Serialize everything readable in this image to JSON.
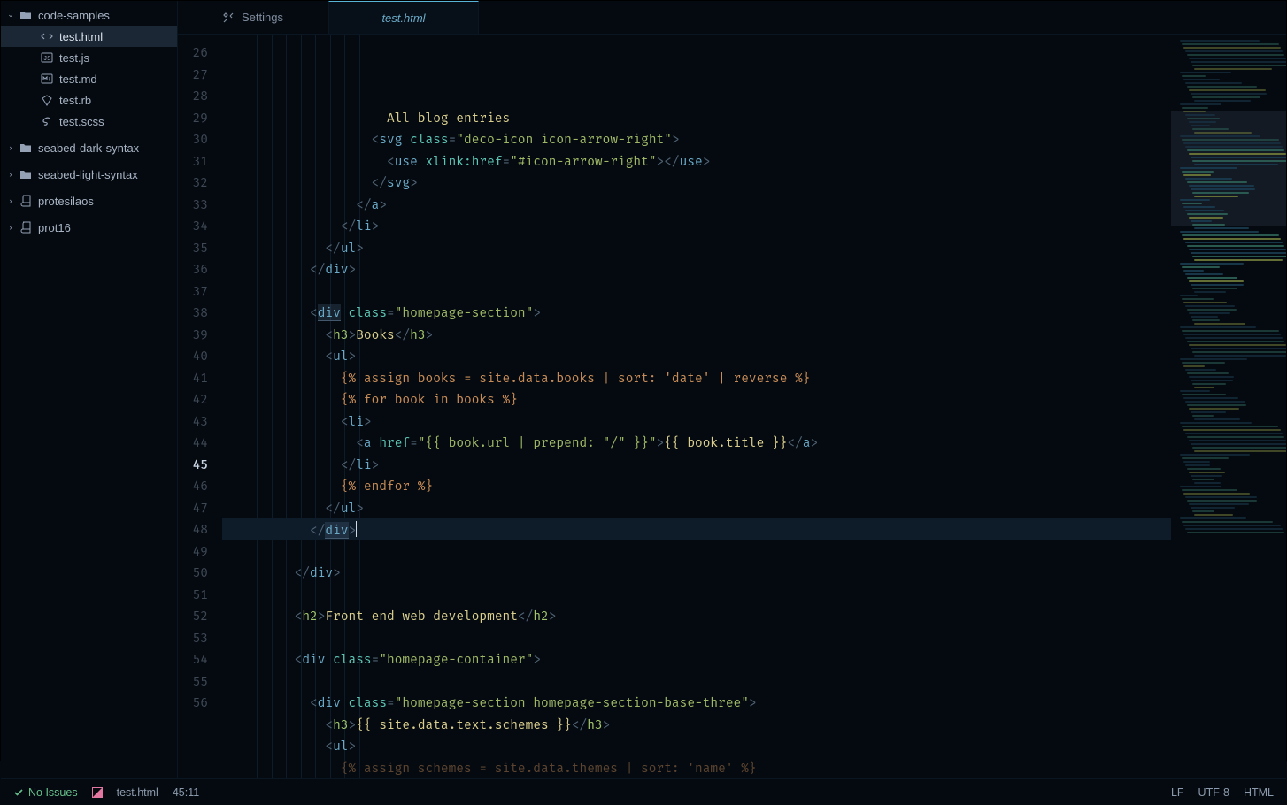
{
  "tree": {
    "root": {
      "name": "code-samples",
      "expanded": true,
      "files": [
        {
          "name": "test.html",
          "kind": "html",
          "active": true
        },
        {
          "name": "test.js",
          "kind": "js",
          "active": false
        },
        {
          "name": "test.md",
          "kind": "md",
          "active": false
        },
        {
          "name": "test.rb",
          "kind": "rb",
          "active": false
        },
        {
          "name": "test.scss",
          "kind": "scss",
          "active": false
        }
      ]
    },
    "siblings": [
      {
        "name": "seabed-dark-syntax",
        "icon": "folder"
      },
      {
        "name": "seabed-light-syntax",
        "icon": "folder"
      },
      {
        "name": "protesilaos",
        "icon": "repo"
      },
      {
        "name": "prot16",
        "icon": "repo"
      }
    ]
  },
  "tabs": [
    {
      "id": "settings",
      "label": "Settings",
      "icon": "tools",
      "active": false,
      "italic": false
    },
    {
      "id": "testhtml",
      "label": "test.html",
      "icon": "html",
      "active": true,
      "italic": true
    }
  ],
  "gutter": {
    "start": 26,
    "end": 56,
    "current": 45
  },
  "code": [
    {
      "n": 26,
      "ind": 10,
      "html": "<span class='tx'>All blog entries</span>"
    },
    {
      "n": 27,
      "ind": 9,
      "html": "<span class='pn'>&lt;</span><span class='tg'>svg</span> <span class='an'>class</span><span class='pn'>=</span><span class='as'>\"deco-icon icon-arrow-right\"</span><span class='pn'>&gt;</span>"
    },
    {
      "n": 28,
      "ind": 10,
      "html": "<span class='pn'>&lt;</span><span class='tg'>use</span> <span class='an'>xlink:href</span><span class='pn'>=</span><span class='as'>\"#icon-arrow-right\"</span><span class='pn'>&gt;&lt;/</span><span class='tg'>use</span><span class='pn'>&gt;</span>"
    },
    {
      "n": 29,
      "ind": 9,
      "html": "<span class='pn'>&lt;/</span><span class='tg'>svg</span><span class='pn'>&gt;</span>"
    },
    {
      "n": 30,
      "ind": 8,
      "html": "<span class='pn'>&lt;/</span><span class='tg'>a</span><span class='pn'>&gt;</span>"
    },
    {
      "n": 31,
      "ind": 7,
      "html": "<span class='pn'>&lt;/</span><span class='tg'>li</span><span class='pn'>&gt;</span>"
    },
    {
      "n": 32,
      "ind": 6,
      "html": "<span class='pn'>&lt;/</span><span class='tg'>ul</span><span class='pn'>&gt;</span>"
    },
    {
      "n": 33,
      "ind": 5,
      "html": "<span class='pn'>&lt;/</span><span class='tg'>div</span><span class='pn'>&gt;</span>"
    },
    {
      "n": 34,
      "ind": 0,
      "html": ""
    },
    {
      "n": 35,
      "ind": 5,
      "html": "<span class='pn'>&lt;</span><span class='tg hl-match'>div</span> <span class='an'>class</span><span class='pn'>=</span><span class='as'>\"homepage-section\"</span><span class='pn'>&gt;</span>"
    },
    {
      "n": 36,
      "ind": 6,
      "html": "<span class='pn'>&lt;</span><span class='at'>h3</span><span class='pn'>&gt;</span><span class='tx'>Books</span><span class='pn'>&lt;/</span><span class='at'>h3</span><span class='pn'>&gt;</span>"
    },
    {
      "n": 37,
      "ind": 6,
      "html": "<span class='pn'>&lt;</span><span class='tg'>ul</span><span class='pn'>&gt;</span>"
    },
    {
      "n": 38,
      "ind": 7,
      "html": "<span class='lq'>{% assign books = site.data.books | sort: 'date' | reverse %}</span>"
    },
    {
      "n": 39,
      "ind": 7,
      "html": "<span class='lq'>{% for book in books %}</span>"
    },
    {
      "n": 40,
      "ind": 7,
      "html": "<span class='pn'>&lt;</span><span class='tg'>li</span><span class='pn'>&gt;</span>"
    },
    {
      "n": 41,
      "ind": 8,
      "html": "<span class='pn'>&lt;</span><span class='tg'>a</span> <span class='an'>href</span><span class='pn'>=</span><span class='as'>\"{{ book.url | prepend: \"/\" }}\"</span><span class='pn'>&gt;</span><span class='tx'>{{ book.title }}</span><span class='pn'>&lt;/</span><span class='tg'>a</span><span class='pn'>&gt;</span>"
    },
    {
      "n": 42,
      "ind": 7,
      "html": "<span class='pn'>&lt;/</span><span class='tg'>li</span><span class='pn'>&gt;</span>"
    },
    {
      "n": 43,
      "ind": 7,
      "html": "<span class='lq'>{% endfor %}</span>"
    },
    {
      "n": 44,
      "ind": 6,
      "html": "<span class='pn'>&lt;/</span><span class='tg'>ul</span><span class='pn'>&gt;</span>"
    },
    {
      "n": 45,
      "ind": 5,
      "html": "<span class='pn'>&lt;/</span><span class='tg hl-match'>div</span><span class='pn'>&gt;</span><span class='caret'></span>",
      "cur": true
    },
    {
      "n": 46,
      "ind": 0,
      "html": ""
    },
    {
      "n": 47,
      "ind": 4,
      "html": "<span class='pn'>&lt;/</span><span class='tg'>div</span><span class='pn'>&gt;</span>"
    },
    {
      "n": 48,
      "ind": 0,
      "html": ""
    },
    {
      "n": 49,
      "ind": 4,
      "html": "<span class='pn'>&lt;</span><span class='at'>h2</span><span class='pn'>&gt;</span><span class='tx'>Front end web development</span><span class='pn'>&lt;/</span><span class='at'>h2</span><span class='pn'>&gt;</span>"
    },
    {
      "n": 50,
      "ind": 0,
      "html": ""
    },
    {
      "n": 51,
      "ind": 4,
      "html": "<span class='pn'>&lt;</span><span class='tg'>div</span> <span class='an'>class</span><span class='pn'>=</span><span class='as'>\"homepage-container\"</span><span class='pn'>&gt;</span>"
    },
    {
      "n": 52,
      "ind": 0,
      "html": ""
    },
    {
      "n": 53,
      "ind": 5,
      "html": "<span class='pn'>&lt;</span><span class='tg'>div</span> <span class='an'>class</span><span class='pn'>=</span><span class='as'>\"homepage-section homepage-section-base-three\"</span><span class='pn'>&gt;</span>"
    },
    {
      "n": 54,
      "ind": 6,
      "html": "<span class='pn'>&lt;</span><span class='at'>h3</span><span class='pn'>&gt;</span><span class='tx'>{{ site.data.text.schemes }}</span><span class='pn'>&lt;/</span><span class='at'>h3</span><span class='pn'>&gt;</span>"
    },
    {
      "n": 55,
      "ind": 6,
      "html": "<span class='pn'>&lt;</span><span class='tg'>ul</span><span class='pn'>&gt;</span>"
    },
    {
      "n": 56,
      "ind": 7,
      "html": "<span class='lq'>{% assign schemes = site.data.themes | sort: 'name' %}</span>",
      "fade": true
    }
  ],
  "status": {
    "issues": "No Issues",
    "file": "test.html",
    "cursor": "45:11",
    "eol": "LF",
    "enc": "UTF-8",
    "lang": "HTML"
  },
  "colors": {
    "bg": "#050a10",
    "panel": "#0e1b29",
    "text": "#a8b4c4",
    "tag": "#6aaac8",
    "attr": "#5dc6b5",
    "str": "#9fb866",
    "yellow": "#dacf8e",
    "orange": "#c78c57",
    "green": "#66c08b",
    "pink": "#e477a2"
  }
}
